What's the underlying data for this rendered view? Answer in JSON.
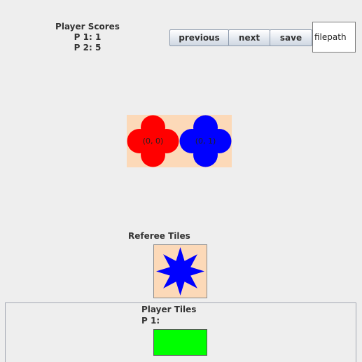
{
  "scores": {
    "title": "Player Scores",
    "lines": [
      "P 1: 1",
      "P 2: 5"
    ]
  },
  "toolbar": {
    "previous_label": "previous",
    "next_label": "next",
    "save_label": "save",
    "filepath_value": "filepath"
  },
  "board": {
    "tiles": [
      {
        "coord": "(0, 0)",
        "shape": "clover",
        "color": "#ff0000"
      },
      {
        "coord": "(0, 1)",
        "shape": "clover",
        "color": "#0000ff"
      }
    ],
    "background": "#fcd9b8"
  },
  "referee": {
    "label": "Referee Tiles",
    "tile": {
      "shape": "8-star",
      "color": "#0000ff"
    }
  },
  "player_tiles": {
    "title": "Player Tiles",
    "player_label": "P 1:",
    "tile_color": "#00ff00"
  }
}
